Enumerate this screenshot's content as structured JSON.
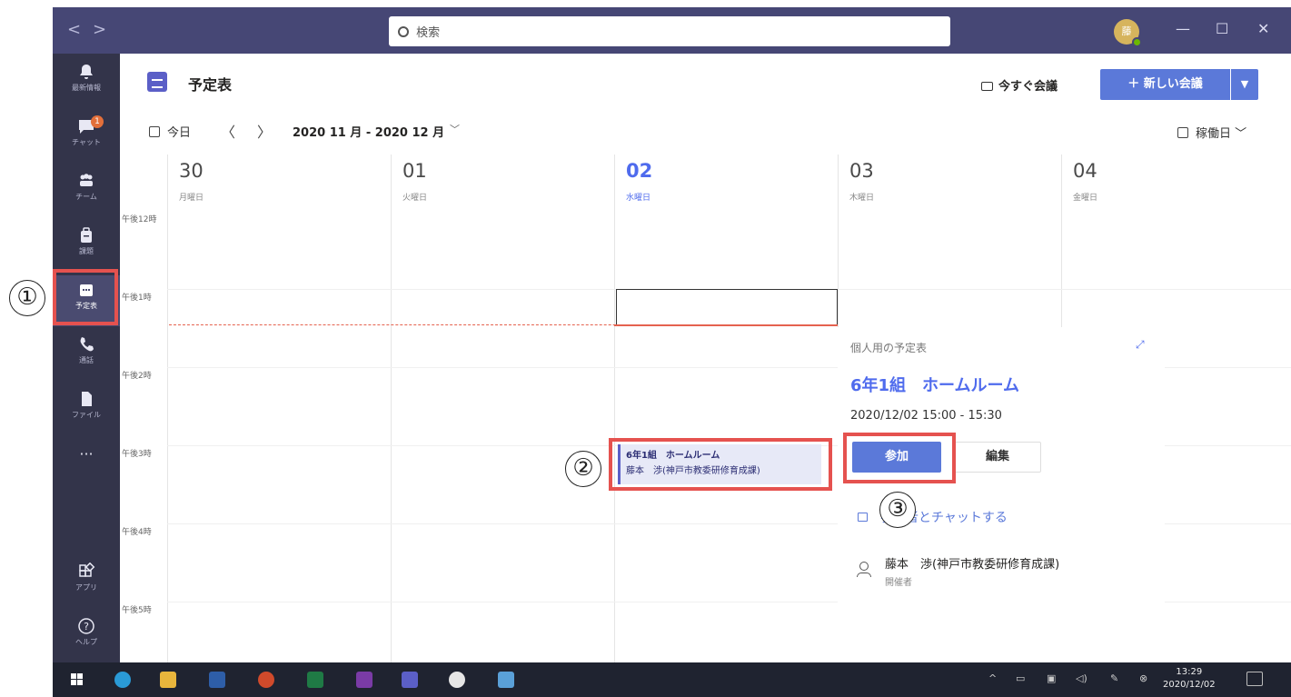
{
  "annotations": {
    "m1": "①",
    "m2": "②",
    "m3": "③"
  },
  "titlebar": {
    "back": "<",
    "forward": ">",
    "search_placeholder": "検索",
    "avatar_initial": "藤",
    "minimize": "—",
    "maximize": "☐",
    "close": "✕"
  },
  "rail": {
    "items": [
      {
        "label": "最新情報"
      },
      {
        "label": "チャット",
        "badge": "1"
      },
      {
        "label": "チーム"
      },
      {
        "label": "課題"
      },
      {
        "label": "予定表"
      },
      {
        "label": "通話"
      },
      {
        "label": "ファイル"
      },
      {
        "label": "···"
      },
      {
        "label": "アプリ"
      },
      {
        "label": "ヘルプ"
      }
    ]
  },
  "header": {
    "title": "予定表",
    "meet_now": "今すぐ会議",
    "new_meeting": "＋ 新しい会議"
  },
  "toolbar": {
    "today": "今日",
    "prev": "〈",
    "next": "〉",
    "range": "2020 11 月 - 2020 12 月",
    "view": "稼働日"
  },
  "days": [
    {
      "num": "30",
      "name": "月曜日"
    },
    {
      "num": "01",
      "name": "火曜日"
    },
    {
      "num": "02",
      "name": "水曜日"
    },
    {
      "num": "03",
      "name": "木曜日"
    },
    {
      "num": "04",
      "name": "金曜日"
    }
  ],
  "times": [
    "午後12時",
    "午後1時",
    "午後2時",
    "午後3時",
    "午後4時",
    "午後5時"
  ],
  "event": {
    "title": "6年1組　ホームルーム",
    "organizer": "藤本　渉(神戸市教委研修育成課)"
  },
  "popup": {
    "calendar": "個人用の予定表",
    "title": "6年1組　ホームルーム",
    "time": "2020/12/02 15:00 - 15:30",
    "join": "参加",
    "edit": "編集",
    "chat": "参加者とチャットする",
    "organizer_name": "藤本　渉(神戸市教委研修育成課)",
    "organizer_role": "開催者"
  },
  "taskbar": {
    "time": "13:29",
    "date": "2020/12/02"
  },
  "colors": {
    "rail": "#33344a",
    "titlebar": "#464775",
    "accent": "#5b79d9",
    "highlight": "#e5524f",
    "now": "#e5624f"
  }
}
